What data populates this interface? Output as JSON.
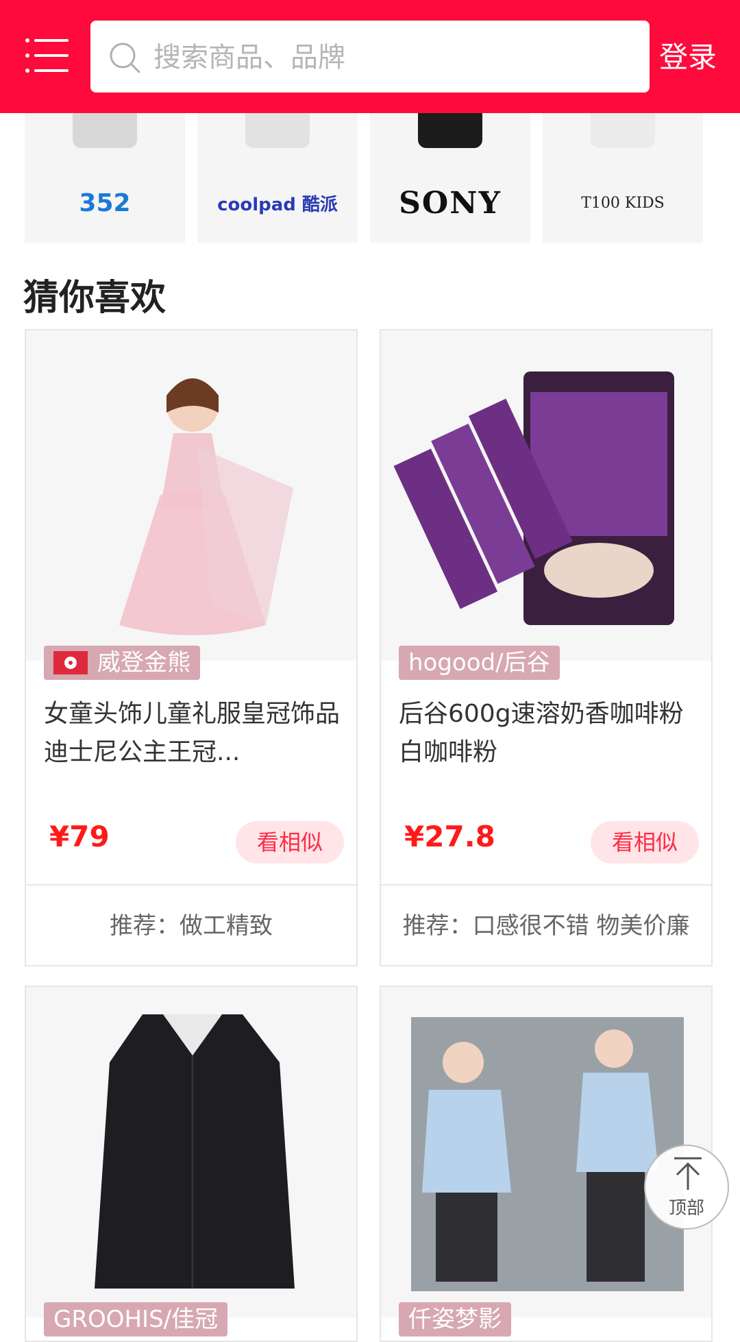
{
  "header": {
    "search_placeholder": "搜索商品、品牌",
    "login_label": "登录"
  },
  "brands": [
    {
      "name": "352"
    },
    {
      "name": "coolpad 酷派"
    },
    {
      "name": "SONY"
    },
    {
      "name": "T100 KIDS"
    }
  ],
  "section": {
    "title": "猜你喜欢"
  },
  "products": [
    {
      "tag": "威登金熊",
      "title": "女童头饰儿童礼服皇冠饰品迪士尼公主王冠...",
      "price": "¥79",
      "similar": "看相似",
      "recommend": "推荐：做工精致"
    },
    {
      "tag": "hogood/后谷",
      "title": "后谷600g速溶奶香咖啡粉白咖啡粉",
      "price": "¥27.8",
      "similar": "看相似",
      "recommend": "推荐：口感很不错 物美价廉"
    },
    {
      "tag": "GROOHIS/佳冠"
    },
    {
      "tag": "仟姿梦影"
    }
  ],
  "back_to_top": {
    "label": "顶部"
  },
  "colors": {
    "brand_red": "#ff0a3c",
    "price_red": "#ff1a1a",
    "tag_pink": "#d7a8b2"
  }
}
